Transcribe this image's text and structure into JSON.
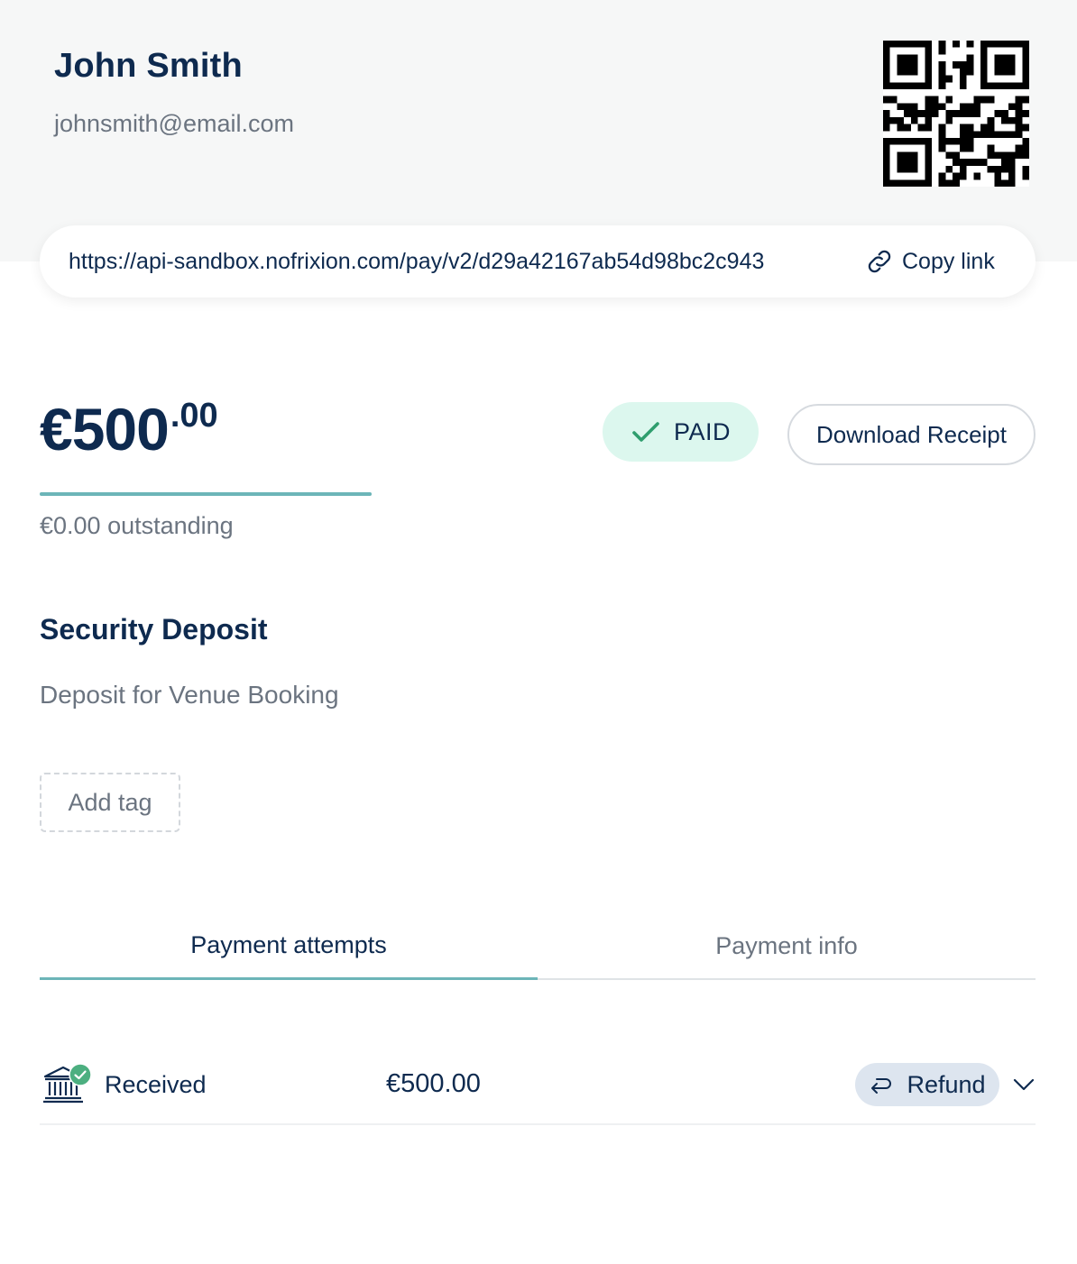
{
  "customer": {
    "name": "John Smith",
    "email": "johnsmith@email.com"
  },
  "payment_link": {
    "url": "https://api-sandbox.nofrixion.com/pay/v2/d29a42167ab54d98bc2c943",
    "copy_label": "Copy link",
    "icon": "link-icon"
  },
  "amount": {
    "main": "€500",
    "cents": ".00",
    "paid_fraction": 1.0,
    "outstanding": "€0.00 outstanding"
  },
  "status": {
    "label": "PAID",
    "icon": "check-icon",
    "color": "#dcf7ee",
    "icon_color": "#2f9e6e"
  },
  "actions": {
    "download_receipt": "Download Receipt",
    "add_tag": "Add tag"
  },
  "payment_request": {
    "title": "Security Deposit",
    "description": "Deposit for Venue Booking"
  },
  "tabs": [
    {
      "label": "Payment attempts",
      "active": true
    },
    {
      "label": "Payment info",
      "active": false
    }
  ],
  "attempts": [
    {
      "icon": "bank-icon",
      "status": "Received",
      "amount": "€500.00",
      "refund_label": "Refund",
      "refund_icon": "refund-arrow-icon",
      "expand_icon": "chevron-down-icon"
    }
  ],
  "colors": {
    "accent": "#6cb5b8",
    "text_primary": "#0e2a4f",
    "text_secondary": "#6b7480"
  }
}
